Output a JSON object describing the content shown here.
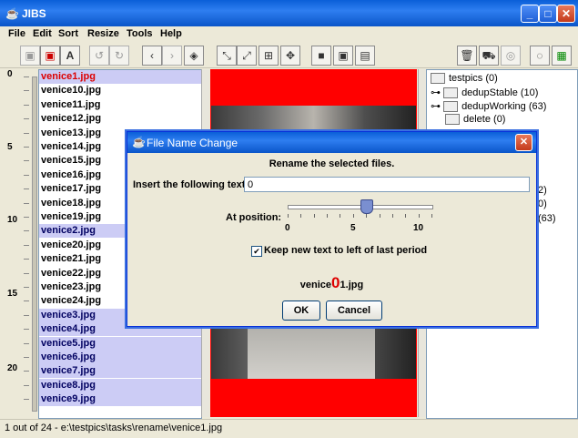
{
  "window": {
    "title": "JIBS"
  },
  "menu": [
    "File",
    "Edit",
    "Sort",
    "Resize",
    "Tools",
    "Help"
  ],
  "ruler": {
    "labels": [
      "0",
      "5",
      "10",
      "15",
      "20"
    ]
  },
  "files": [
    {
      "name": "venice1.jpg",
      "selected": true,
      "first": true
    },
    {
      "name": "venice10.jpg",
      "selected": false
    },
    {
      "name": "venice11.jpg",
      "selected": false
    },
    {
      "name": "venice12.jpg",
      "selected": false
    },
    {
      "name": "venice13.jpg",
      "selected": false
    },
    {
      "name": "venice14.jpg",
      "selected": false
    },
    {
      "name": "venice15.jpg",
      "selected": false
    },
    {
      "name": "venice16.jpg",
      "selected": false
    },
    {
      "name": "venice17.jpg",
      "selected": false
    },
    {
      "name": "venice18.jpg",
      "selected": false
    },
    {
      "name": "venice19.jpg",
      "selected": false
    },
    {
      "name": "venice2.jpg",
      "selected": true
    },
    {
      "name": "venice20.jpg",
      "selected": false
    },
    {
      "name": "venice21.jpg",
      "selected": false
    },
    {
      "name": "venice22.jpg",
      "selected": false
    },
    {
      "name": "venice23.jpg",
      "selected": false
    },
    {
      "name": "venice24.jpg",
      "selected": false
    },
    {
      "name": "venice3.jpg",
      "selected": true
    },
    {
      "name": "venice4.jpg",
      "selected": true
    },
    {
      "name": "venice5.jpg",
      "selected": true
    },
    {
      "name": "venice6.jpg",
      "selected": true
    },
    {
      "name": "venice7.jpg",
      "selected": true
    },
    {
      "name": "venice8.jpg",
      "selected": true
    },
    {
      "name": "venice9.jpg",
      "selected": true
    }
  ],
  "tree": [
    {
      "label": "testpics (0)",
      "level": 0
    },
    {
      "label": "dedupStable (10)",
      "level": 1,
      "expander": true
    },
    {
      "label": "dedupWorking (63)",
      "level": 1,
      "expander": true
    },
    {
      "label": "delete (0)",
      "level": 1
    },
    {
      "label": "2)",
      "level": 2
    },
    {
      "label": "0)",
      "level": 2
    },
    {
      "label": "(63)",
      "level": 2
    }
  ],
  "status": "1 out of 24 - e:\\testpics\\tasks\\rename\\venice1.jpg",
  "dialog": {
    "title": "File Name Change",
    "heading": "Rename the selected files.",
    "insert_label": "Insert the following text:",
    "insert_value": "0",
    "position_label": "At position:",
    "slider_labels": [
      "0",
      "5",
      "10"
    ],
    "slider_value": 6,
    "slider_max": 11,
    "checkbox_label": "Keep new text to left of last period",
    "checkbox_checked": true,
    "preview_prefix": "venice",
    "preview_insert": "0",
    "preview_suffix": "1.jpg",
    "ok_label": "OK",
    "cancel_label": "Cancel"
  }
}
